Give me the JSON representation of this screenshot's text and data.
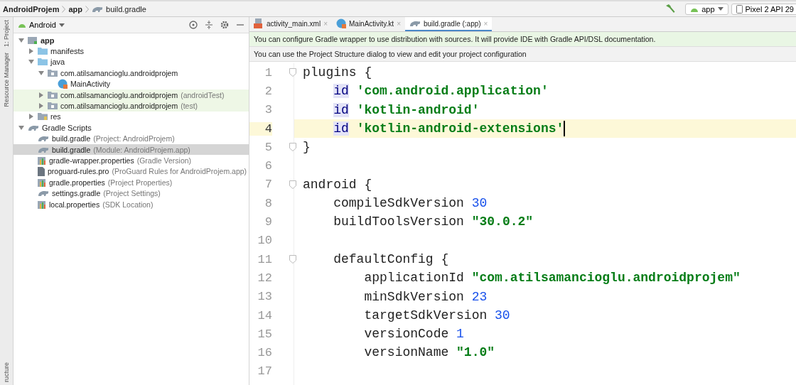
{
  "breadcrumbs": [
    "AndroidProjem",
    "app",
    "build.gradle"
  ],
  "toolbar": {
    "run_config": "app",
    "device": "Pixel 2 API 29"
  },
  "side_strip": [
    "1: Project",
    "Resource Manager",
    "ructure"
  ],
  "project_panel": {
    "view": "Android",
    "tree": [
      {
        "label": "app",
        "kind": "module",
        "expanded": true,
        "selected": false,
        "test": false,
        "children": [
          {
            "label": "manifests",
            "kind": "folder",
            "expanded": false,
            "selected": false,
            "test": false
          },
          {
            "label": "java",
            "kind": "folder",
            "expanded": true,
            "selected": false,
            "test": false,
            "children": [
              {
                "label": "com.atilsamancioglu.androidprojem",
                "kind": "package",
                "expanded": true,
                "selected": false,
                "test": false,
                "children": [
                  {
                    "label": "MainActivity",
                    "kind": "class",
                    "selected": false,
                    "test": false
                  }
                ]
              },
              {
                "label": "com.atilsamancioglu.androidprojem",
                "note": "(androidTest)",
                "kind": "package",
                "expanded": false,
                "selected": false,
                "test": true
              },
              {
                "label": "com.atilsamancioglu.androidprojem",
                "note": "(test)",
                "kind": "package",
                "expanded": false,
                "selected": false,
                "test": true
              }
            ]
          },
          {
            "label": "res",
            "kind": "resfolder",
            "expanded": false,
            "selected": false,
            "test": false
          }
        ]
      },
      {
        "label": "Gradle Scripts",
        "kind": "gradle",
        "expanded": true,
        "selected": false,
        "test": false,
        "children": [
          {
            "label": "build.gradle",
            "note": "(Project: AndroidProjem)",
            "kind": "gradle",
            "selected": false,
            "test": false
          },
          {
            "label": "build.gradle",
            "note": "(Module: AndroidProjem.app)",
            "kind": "gradle",
            "selected": true,
            "test": false
          },
          {
            "label": "gradle-wrapper.properties",
            "note": "(Gradle Version)",
            "kind": "properties",
            "selected": false,
            "test": false
          },
          {
            "label": "proguard-rules.pro",
            "note": "(ProGuard Rules for AndroidProjem.app)",
            "kind": "file",
            "selected": false,
            "test": false
          },
          {
            "label": "gradle.properties",
            "note": "(Project Properties)",
            "kind": "properties",
            "selected": false,
            "test": false
          },
          {
            "label": "settings.gradle",
            "note": "(Project Settings)",
            "kind": "gradle",
            "selected": false,
            "test": false
          },
          {
            "label": "local.properties",
            "note": "(SDK Location)",
            "kind": "properties",
            "selected": false,
            "test": false
          }
        ]
      }
    ]
  },
  "tabs": [
    {
      "label": "activity_main.xml",
      "kind": "xml",
      "selected": false,
      "close": "×"
    },
    {
      "label": "MainActivity.kt",
      "kind": "class",
      "selected": false,
      "close": "×"
    },
    {
      "label": "build.gradle (:app)",
      "kind": "gradle",
      "selected": true,
      "close": "×"
    }
  ],
  "notices": [
    {
      "text": "You can configure Gradle wrapper to use distribution with sources. It will provide IDE with Gradle API/DSL documentation.",
      "kind": "info"
    },
    {
      "text": "You can use the Project Structure dialog to view and edit your project configuration",
      "kind": "plain"
    }
  ],
  "editor": {
    "lines": [
      {
        "number": "1",
        "fold": true,
        "current": false,
        "tokens": [
          {
            "text": "plugins {",
            "kind": "plain"
          }
        ]
      },
      {
        "number": "2",
        "fold": false,
        "current": false,
        "tokens": [
          {
            "text": "    id",
            "kind": "usage"
          },
          {
            "text": " 'com.android.application'",
            "kind": "string"
          }
        ]
      },
      {
        "number": "3",
        "fold": false,
        "current": false,
        "tokens": [
          {
            "text": "    id",
            "kind": "usage"
          },
          {
            "text": " 'kotlin-android'",
            "kind": "string"
          }
        ]
      },
      {
        "number": "4",
        "fold": false,
        "current": true,
        "tokens": [
          {
            "text": "    id",
            "kind": "usage"
          },
          {
            "text": " 'kotlin-android-extensions'",
            "kind": "string"
          }
        ]
      },
      {
        "number": "5",
        "fold": true,
        "current": false,
        "tokens": [
          {
            "text": "}",
            "kind": "plain"
          }
        ]
      },
      {
        "number": "6",
        "fold": false,
        "current": false
      },
      {
        "number": "7",
        "fold": true,
        "current": false,
        "tokens": [
          {
            "text": "android {",
            "kind": "plain"
          }
        ]
      },
      {
        "number": "8",
        "fold": false,
        "current": false,
        "tokens": [
          {
            "text": "    compileSdkVersion ",
            "kind": "plain"
          },
          {
            "text": "30",
            "kind": "number"
          }
        ]
      },
      {
        "number": "9",
        "fold": false,
        "current": false,
        "tokens": [
          {
            "text": "    buildToolsVersion ",
            "kind": "plain"
          },
          {
            "text": "\"30.0.2\"",
            "kind": "string"
          }
        ]
      },
      {
        "number": "10",
        "fold": false,
        "current": false
      },
      {
        "number": "11",
        "fold": true,
        "current": false,
        "tokens": [
          {
            "text": "    defaultConfig {",
            "kind": "plain"
          }
        ]
      },
      {
        "number": "12",
        "fold": false,
        "current": false,
        "tokens": [
          {
            "text": "        applicationId ",
            "kind": "plain"
          },
          {
            "text": "\"com.atilsamancioglu.androidprojem\"",
            "kind": "string"
          }
        ]
      },
      {
        "number": "13",
        "fold": false,
        "current": false,
        "tokens": [
          {
            "text": "        minSdkVersion ",
            "kind": "plain"
          },
          {
            "text": "23",
            "kind": "number"
          }
        ]
      },
      {
        "number": "14",
        "fold": false,
        "current": false,
        "tokens": [
          {
            "text": "        targetSdkVersion ",
            "kind": "plain"
          },
          {
            "text": "30",
            "kind": "number"
          }
        ]
      },
      {
        "number": "15",
        "fold": false,
        "current": false,
        "tokens": [
          {
            "text": "        versionCode ",
            "kind": "plain"
          },
          {
            "text": "1",
            "kind": "number"
          }
        ]
      },
      {
        "number": "16",
        "fold": false,
        "current": false,
        "tokens": [
          {
            "text": "        versionName ",
            "kind": "plain"
          },
          {
            "text": "\"1.0\"",
            "kind": "string"
          }
        ]
      },
      {
        "number": "17",
        "fold": false,
        "current": false
      }
    ]
  }
}
